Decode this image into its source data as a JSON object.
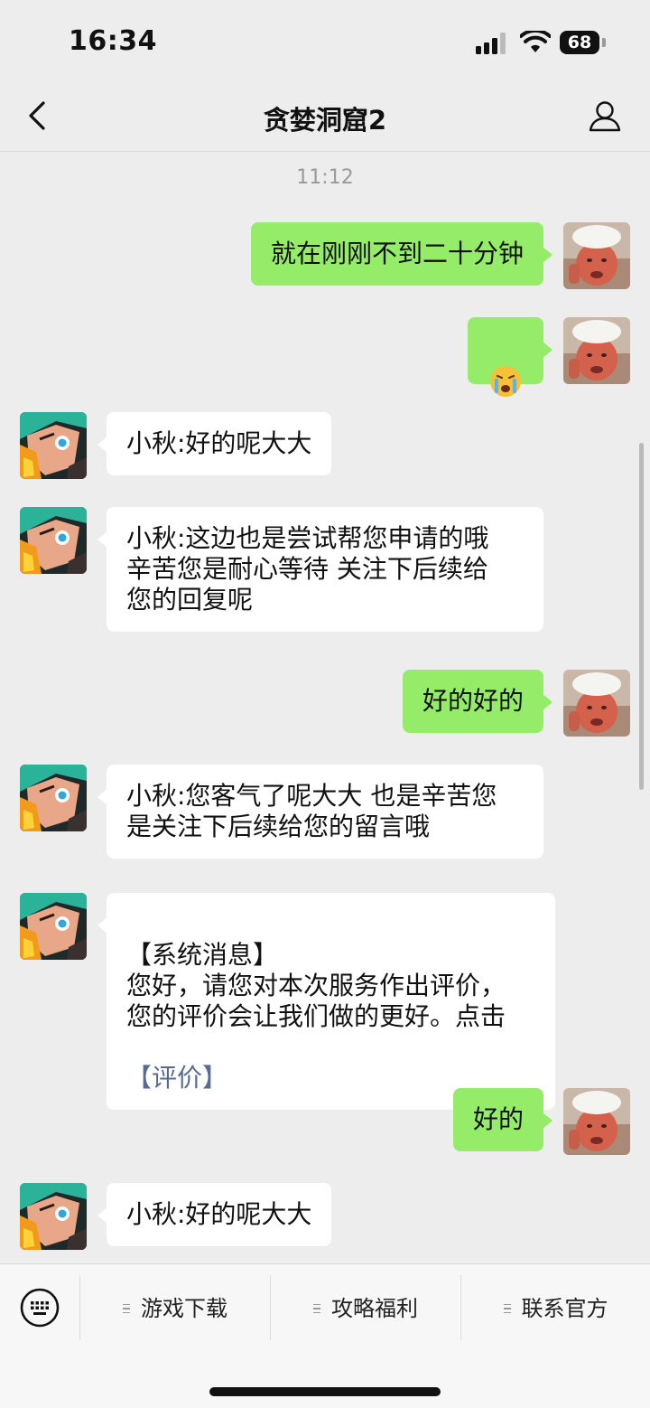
{
  "status": {
    "time": "16:34",
    "battery": "68"
  },
  "nav": {
    "title": "贪婪洞窟2"
  },
  "chat": {
    "timestamp": "11:12",
    "messages": [
      {
        "side": "me",
        "text": "就在刚刚不到二十分钟"
      },
      {
        "side": "me",
        "emoji": "crying-face-emoji"
      },
      {
        "side": "agent",
        "text": "小秋:好的呢大大"
      },
      {
        "side": "agent",
        "text": "小秋:这边也是尝试帮您申请的哦\n辛苦您是耐心等待 关注下后续给\n您的回复呢"
      },
      {
        "side": "me",
        "text": "好的好的"
      },
      {
        "side": "agent",
        "text": "小秋:您客气了呢大大 也是辛苦您\n是关注下后续给您的留言哦"
      },
      {
        "side": "agent",
        "text": "【系统消息】\n您好，请您对本次服务作出评价，\n您的评价会让我们做的更好。点击",
        "link": "【评价】"
      },
      {
        "side": "me",
        "text": "好的"
      },
      {
        "side": "agent",
        "text": "小秋:好的呢大大"
      }
    ]
  },
  "bottom_menu": {
    "items": [
      {
        "label": "游戏下载"
      },
      {
        "label": "攻略福利"
      },
      {
        "label": "联系官方"
      }
    ]
  },
  "colors": {
    "me_bubble": "#95ec69",
    "agent_bubble": "#ffffff",
    "background": "#ededed",
    "link": "#576b95"
  }
}
